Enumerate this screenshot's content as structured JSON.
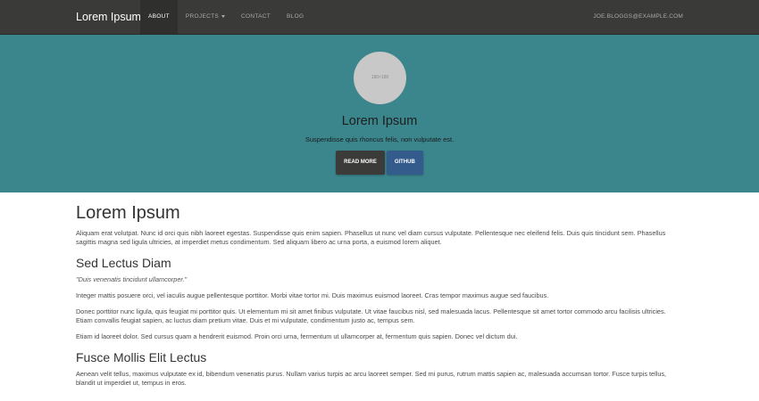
{
  "colors": {
    "navbar_bg": "#3a3a38",
    "hero_bg": "#3b868d",
    "read_more_bg": "#3b3b39",
    "github_bg": "#335b8c"
  },
  "navbar": {
    "brand": "Lorem Ipsum",
    "items": [
      {
        "label": "ABOUT",
        "active": true
      },
      {
        "label": "PROJECTS",
        "dropdown": true
      },
      {
        "label": "CONTACT"
      },
      {
        "label": "BLOG"
      }
    ],
    "user_email": "JOE.BLOGGS@EXAMPLE.COM"
  },
  "hero": {
    "avatar_placeholder": "180×180",
    "title": "Lorem Ipsum",
    "subtitle": "Suspendisse quis rhoncus felis, non vulputate est.",
    "read_more_label": "READ MORE",
    "github_label": "GITHUB"
  },
  "content": {
    "heading": "Lorem Ipsum",
    "intro": "Aliquam erat volutpat. Nunc id orci quis nibh laoreet egestas. Suspendisse quis enim sapien. Phasellus ut nunc vel diam cursus vulputate. Pellentesque nec eleifend felis. Duis quis tincidunt sem. Phasellus sagittis magna sed ligula ultricies, at imperdiet metus condimentum. Sed aliquam libero ac urna porta, a euismod lorem aliquet.",
    "section1": {
      "heading": "Sed Lectus Diam",
      "quote": "\"Duis venenatis tincidunt ullamcorper.\"",
      "p1": "Integer mattis posuere orci, vel iaculis augue pellentesque porttitor. Morbi vitae tortor mi. Duis maximus euismod laoreet. Cras tempor maximus augue sed faucibus.",
      "p2": "Donec porttitor nunc ligula, quis feugiat mi porttitor quis. Ut elementum mi sit amet finibus vulputate. Ut vitae faucibus nisl, sed malesuada lacus. Pellentesque sit amet tortor commodo arcu facilisis ultricies. Etiam convallis feugiat sapien, ac luctus diam pretium vitae. Duis et mi vulputate, condimentum justo ac, tempus sem.",
      "p3": "Etiam id laoreet dolor. Sed cursus quam a hendrerit euismod. Proin orci urna, fermentum ut ullamcorper at, fermentum quis sapien. Donec vel dictum dui."
    },
    "section2": {
      "heading": "Fusce Mollis Elit Lectus",
      "p1": "Aenean velit tellus, maximus vulputate ex id, bibendum venenatis purus. Nullam varius turpis ac arcu laoreet semper. Sed mi purus, rutrum mattis sapien ac, malesuada accumsan tortor. Fusce turpis tellus, blandit ut imperdiet ut, tempus in eros."
    }
  }
}
